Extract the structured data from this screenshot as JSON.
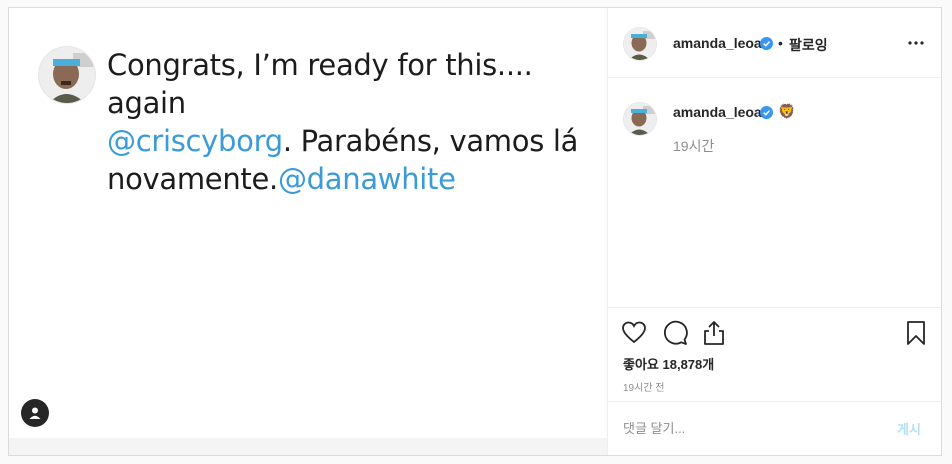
{
  "post": {
    "tweet_text_1": "Congrats, I’m ready for this.... again",
    "tweet_mention_1": "@criscyborg",
    "tweet_text_2": ". Parabéns, vamos lá",
    "tweet_text_3": "novamente.",
    "tweet_mention_2": "@danawhite"
  },
  "header": {
    "username": "amanda_leoa",
    "separator": "•",
    "follow_label": "팔로잉"
  },
  "caption": {
    "username": "amanda_leoa",
    "emoji": "🦁",
    "relative_time": "19시간"
  },
  "engagement": {
    "likes_label": "좋아요 18,878개",
    "posted_time": "19시간 전"
  },
  "comment": {
    "placeholder": "댓글 달기...",
    "post_label": "게시"
  },
  "colors": {
    "mention": "#3a9bd8",
    "verified": "#3897f0",
    "post_button": "#b2dffc"
  }
}
